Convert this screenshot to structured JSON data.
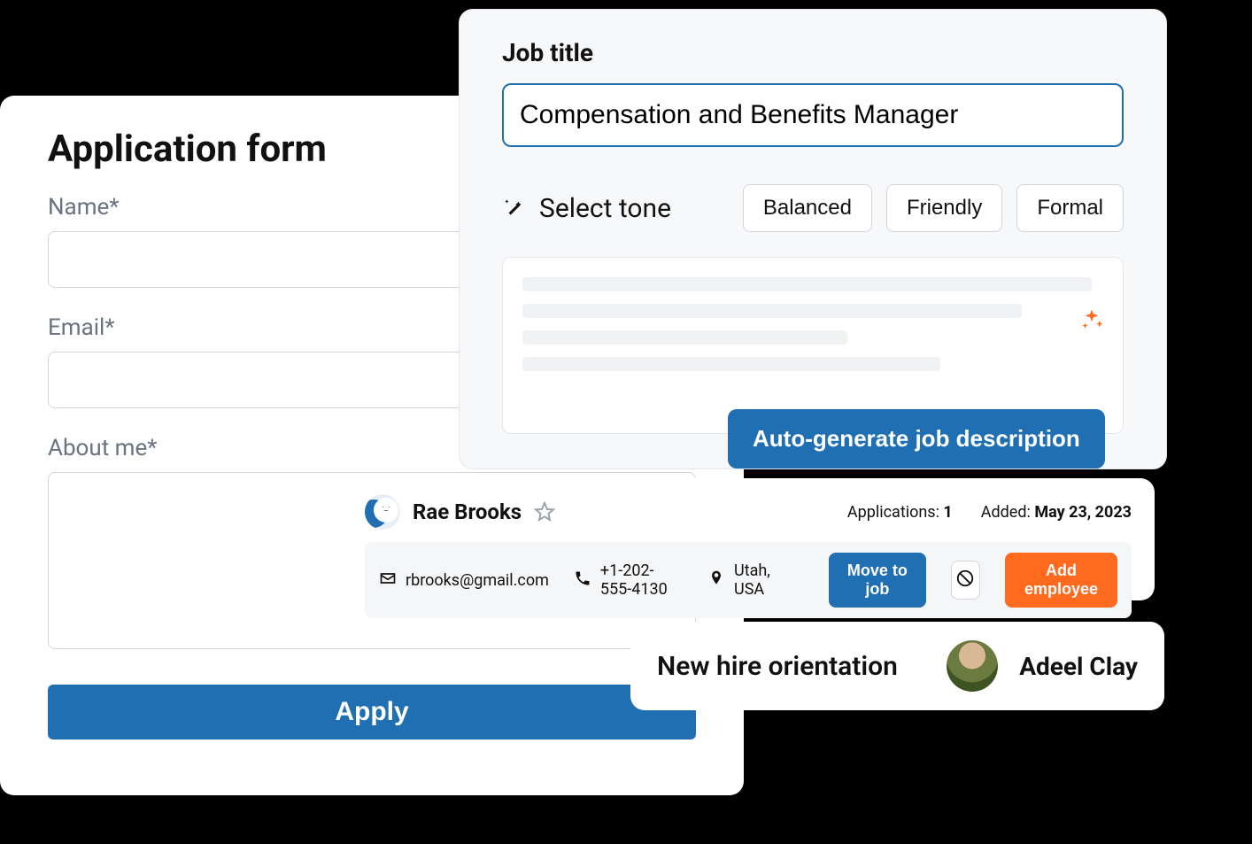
{
  "applicationForm": {
    "title": "Application form",
    "fields": {
      "name_label": "Name*",
      "email_label": "Email*",
      "about_label": "About me*"
    },
    "apply_label": "Apply"
  },
  "jobPanel": {
    "job_title_label": "Job title",
    "job_title_value": "Compensation and Benefits Manager",
    "select_tone_label": "Select tone",
    "tones": {
      "balanced": "Balanced",
      "friendly": "Friendly",
      "formal": "Formal"
    },
    "autogen_label": "Auto-generate job description"
  },
  "candidate": {
    "name": "Rae Brooks",
    "email": "rbrooks@gmail.com",
    "phone": "+1-202-555-4130",
    "location": "Utah, USA",
    "applications_label": "Applications: ",
    "applications_value": "1",
    "added_label": "Added: ",
    "added_value": "May 23, 2023",
    "move_to_job_label": "Move to job",
    "add_employee_label": "Add employee"
  },
  "orientation": {
    "title": "New hire orientation",
    "name": "Adeel Clay"
  }
}
